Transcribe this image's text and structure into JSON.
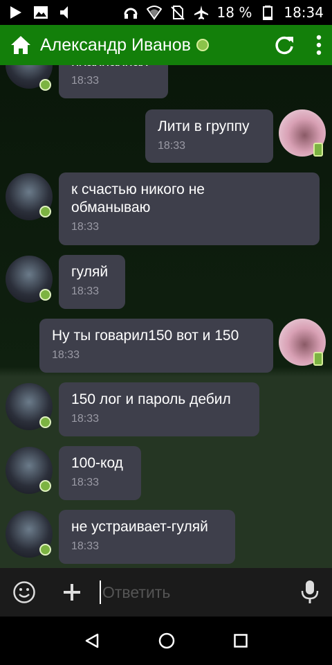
{
  "status_bar": {
    "icons_left": [
      "play-icon",
      "image-icon",
      "volume-icon"
    ],
    "icons_right": [
      "headphones-icon",
      "wifi-icon",
      "no-sim-icon",
      "airplane-icon"
    ],
    "battery_percent": "18 %",
    "time": "18:34"
  },
  "app_bar": {
    "home_icon": "home-icon",
    "contact_name": "Александр Иванов",
    "online": true,
    "refresh_icon": "refresh-icon",
    "menu_icon": "more-vert-icon"
  },
  "messages": [
    {
      "side": "left",
      "text": "пхахпахпах",
      "time": "18:33"
    },
    {
      "side": "right",
      "text": "Лити в группу",
      "time": "18:33"
    },
    {
      "side": "left",
      "text": "к счастью никого не\nобманываю",
      "time": "18:33"
    },
    {
      "side": "left",
      "text": "гуляй",
      "time": "18:33"
    },
    {
      "side": "right",
      "text": "Ну ты говарил150 вот и 150",
      "time": "18:33"
    },
    {
      "side": "left",
      "text": "150 лог и пароль дебил",
      "time": "18:33"
    },
    {
      "side": "left",
      "text": "100-код",
      "time": "18:33"
    },
    {
      "side": "left",
      "text": "не устраивает-гуляй",
      "time": "18:33"
    }
  ],
  "composer": {
    "emoji_icon": "emoji-icon",
    "attach_icon": "plus-icon",
    "placeholder": "Ответить",
    "mic_icon": "microphone-icon"
  },
  "nav_bar": {
    "icons": [
      "back-icon",
      "home-circle-icon",
      "recents-icon"
    ]
  },
  "colors": {
    "app_bar": "#137f0a",
    "bubble": "#3e3f4b",
    "online": "#7cb342"
  }
}
